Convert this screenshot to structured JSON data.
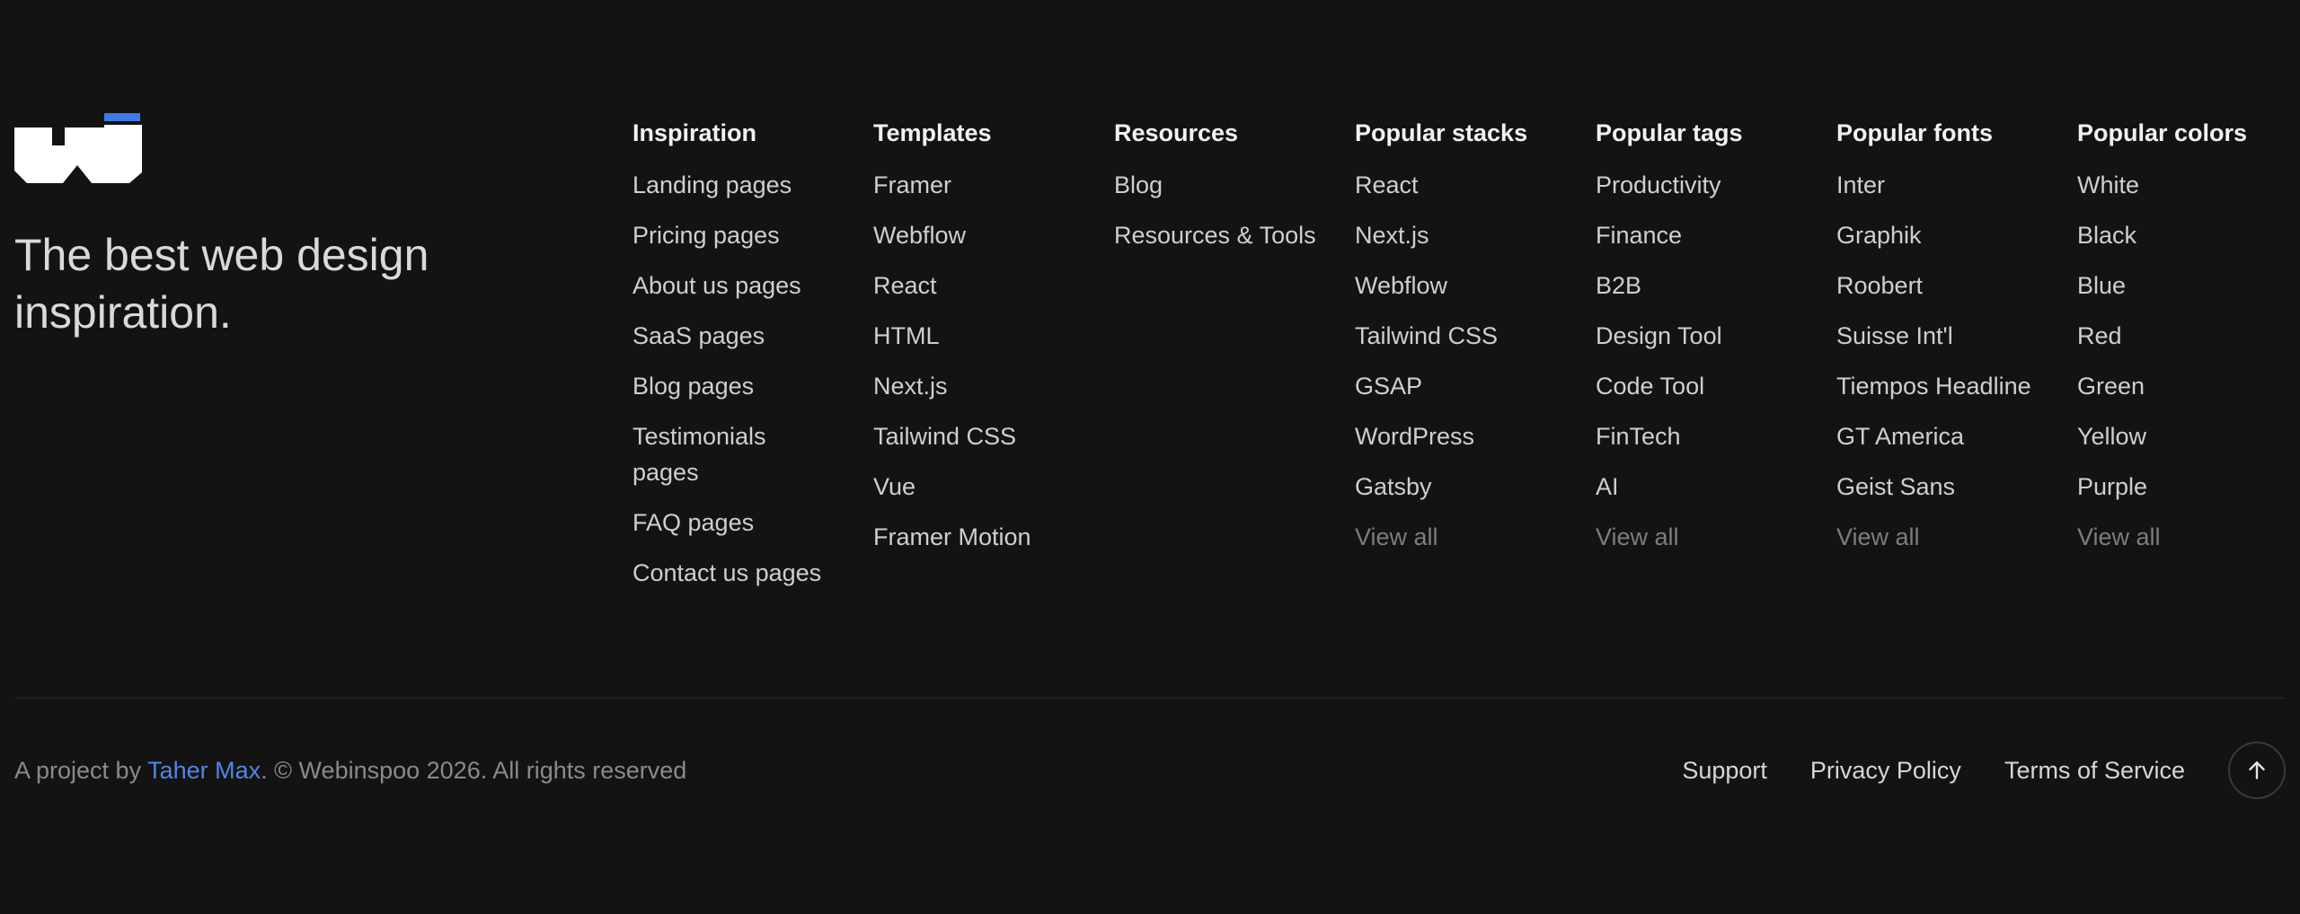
{
  "brand": {
    "tagline": "The best web design inspiration.",
    "logo_icon": "webinspoo-logo-icon",
    "accent_color": "#3d7be6"
  },
  "columns": [
    {
      "heading": "Inspiration",
      "items": [
        "Landing pages",
        "Pricing pages",
        "About us pages",
        "SaaS pages",
        "Blog pages",
        "Testimonials pages",
        "FAQ pages",
        "Contact us pages"
      ]
    },
    {
      "heading": "Templates",
      "items": [
        "Framer",
        "Webflow",
        "React",
        "HTML",
        "Next.js",
        "Tailwind CSS",
        "Vue",
        "Framer Motion"
      ]
    },
    {
      "heading": "Resources",
      "items": [
        "Blog",
        "Resources & Tools"
      ]
    },
    {
      "heading": "Popular stacks",
      "items": [
        "React",
        "Next.js",
        "Webflow",
        "Tailwind CSS",
        "GSAP",
        "WordPress",
        "Gatsby"
      ],
      "view_all": "View all"
    },
    {
      "heading": "Popular tags",
      "items": [
        "Productivity",
        "Finance",
        "B2B",
        "Design Tool",
        "Code Tool",
        "FinTech",
        "AI"
      ],
      "view_all": "View all"
    },
    {
      "heading": "Popular fonts",
      "items": [
        "Inter",
        "Graphik",
        "Roobert",
        "Suisse Int'l",
        "Tiempos Headline",
        "GT America",
        "Geist Sans"
      ],
      "view_all": "View all"
    },
    {
      "heading": "Popular colors",
      "items": [
        "White",
        "Black",
        "Blue",
        "Red",
        "Green",
        "Yellow",
        "Purple"
      ],
      "view_all": "View all"
    }
  ],
  "bottom": {
    "prefix": "A project by ",
    "author": "Taher Max",
    "suffix": ". © Webinspoo 2026. All rights reserved",
    "author_color": "#4f86e8",
    "links": [
      "Support",
      "Privacy Policy",
      "Terms of Service"
    ],
    "top_icon": "arrow-up-icon"
  }
}
